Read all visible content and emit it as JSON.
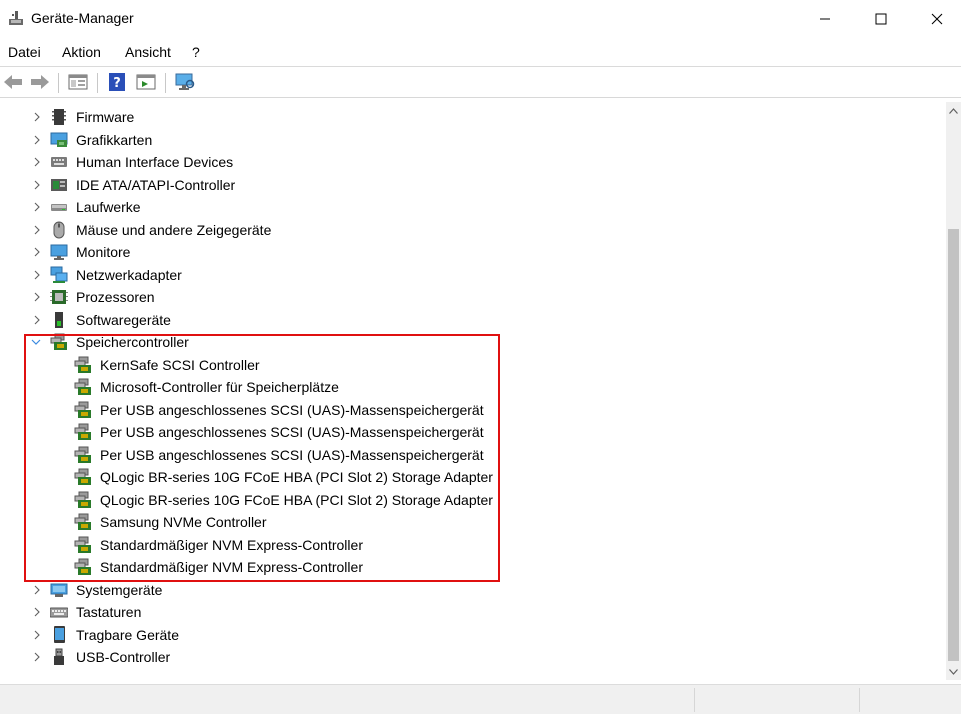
{
  "window": {
    "title": "Geräte-Manager"
  },
  "menu": {
    "items": [
      "Datei",
      "Aktion",
      "Ansicht",
      "?"
    ]
  },
  "toolbar": {
    "buttons": [
      "back-arrow",
      "forward-arrow",
      "properties",
      "help",
      "update-driver",
      "scan-hardware"
    ]
  },
  "tree": {
    "categories_top": [
      {
        "label": "Firmware",
        "icon": "firmware-icon"
      },
      {
        "label": "Grafikkarten",
        "icon": "display-adapter-icon"
      },
      {
        "label": "Human Interface Devices",
        "icon": "hid-icon"
      },
      {
        "label": "IDE ATA/ATAPI-Controller",
        "icon": "ide-controller-icon"
      },
      {
        "label": "Laufwerke",
        "icon": "disk-drive-icon"
      },
      {
        "label": "Mäuse und andere Zeigegeräte",
        "icon": "mouse-icon"
      },
      {
        "label": "Monitore",
        "icon": "monitor-icon"
      },
      {
        "label": "Netzwerkadapter",
        "icon": "network-adapter-icon"
      },
      {
        "label": "Prozessoren",
        "icon": "processor-icon"
      },
      {
        "label": "Softwaregeräte",
        "icon": "software-device-icon"
      }
    ],
    "expanded": {
      "label": "Speichercontroller",
      "icon": "storage-controller-icon",
      "children": [
        "KernSafe SCSI Controller",
        "Microsoft-Controller für Speicherplätze",
        "Per USB angeschlossenes SCSI (UAS)-Massenspeichergerät",
        "Per USB angeschlossenes SCSI (UAS)-Massenspeichergerät",
        "Per USB angeschlossenes SCSI (UAS)-Massenspeichergerät",
        "QLogic BR-series 10G FCoE HBA (PCI Slot 2) Storage Adapter",
        "QLogic BR-series 10G FCoE HBA (PCI Slot 2) Storage Adapter",
        "Samsung NVMe Controller",
        "Standardmäßiger NVM Express-Controller",
        "Standardmäßiger NVM Express-Controller"
      ]
    },
    "categories_bottom": [
      {
        "label": "Systemgeräte",
        "icon": "system-device-icon"
      },
      {
        "label": "Tastaturen",
        "icon": "keyboard-icon"
      },
      {
        "label": "Tragbare Geräte",
        "icon": "portable-device-icon"
      },
      {
        "label": "USB-Controller",
        "icon": "usb-controller-icon"
      }
    ]
  },
  "colors": {
    "highlight": "#e01010",
    "selection": "#cce8ff"
  }
}
